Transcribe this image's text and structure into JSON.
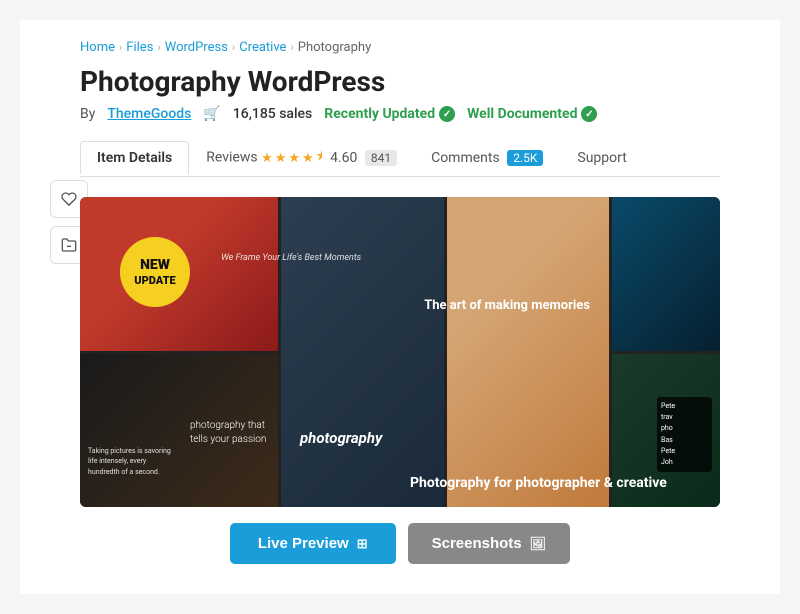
{
  "breadcrumb": {
    "items": [
      "Home",
      "Files",
      "WordPress",
      "Creative",
      "Photography"
    ],
    "separators": [
      "›",
      "›",
      "›",
      "›"
    ]
  },
  "page": {
    "title": "Photography WordPress",
    "author_by": "By",
    "author_name": "ThemeGoods",
    "sales_label": "16,185 sales",
    "recently_updated": "Recently Updated",
    "well_documented": "Well Documented"
  },
  "tabs": {
    "item_details": "Item Details",
    "reviews": "Reviews",
    "rating_value": "4.60",
    "review_count": "841",
    "comments": "Comments",
    "comments_count": "2.5K",
    "support": "Support"
  },
  "image": {
    "new_badge_line1": "NEW",
    "new_badge_line2": "UPDATE",
    "text_photography_passion": "photography that tells your passion",
    "text_frame_moments": "We Frame Your Life's Best Moments",
    "text_photography_center": "photography",
    "text_art_memories": "The art of making memories",
    "text_bottom": "Photography for photographer & creative",
    "text_taking_pictures": "Taking pictures is savoring life intensely, every hundredth of a second.",
    "right_names": [
      "Pete",
      "trav",
      "pho",
      "Bas",
      "Pete",
      "Joh"
    ]
  },
  "buttons": {
    "live_preview": "Live Preview",
    "screenshots": "Screenshots"
  },
  "colors": {
    "accent_blue": "#1a9dd8",
    "green_badge": "#2e9e4f",
    "star_color": "#f5a623"
  }
}
